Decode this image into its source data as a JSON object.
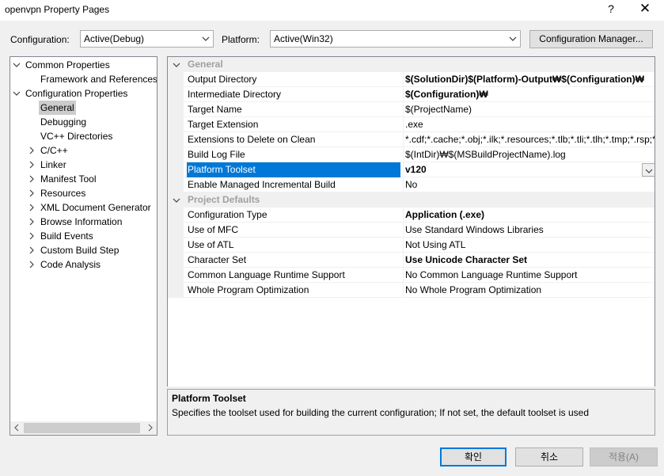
{
  "window": {
    "title": "openvpn Property Pages",
    "help_label": "?",
    "close_label": "✕"
  },
  "toolbar": {
    "configuration_label": "Configuration:",
    "configuration_value": "Active(Debug)",
    "platform_label": "Platform:",
    "platform_value": "Active(Win32)",
    "config_manager_label": "Configuration Manager..."
  },
  "tree": {
    "items": [
      {
        "label": "Common Properties",
        "level": 0,
        "expander": "expanded"
      },
      {
        "label": "Framework and References",
        "level": 1,
        "expander": "none"
      },
      {
        "label": "Configuration Properties",
        "level": 0,
        "expander": "expanded"
      },
      {
        "label": "General",
        "level": 1,
        "expander": "none",
        "selected": true
      },
      {
        "label": "Debugging",
        "level": 1,
        "expander": "none"
      },
      {
        "label": "VC++ Directories",
        "level": 1,
        "expander": "none"
      },
      {
        "label": "C/C++",
        "level": 1,
        "expander": "collapsed"
      },
      {
        "label": "Linker",
        "level": 1,
        "expander": "collapsed"
      },
      {
        "label": "Manifest Tool",
        "level": 1,
        "expander": "collapsed"
      },
      {
        "label": "Resources",
        "level": 1,
        "expander": "collapsed"
      },
      {
        "label": "XML Document Generator",
        "level": 1,
        "expander": "collapsed"
      },
      {
        "label": "Browse Information",
        "level": 1,
        "expander": "collapsed"
      },
      {
        "label": "Build Events",
        "level": 1,
        "expander": "collapsed"
      },
      {
        "label": "Custom Build Step",
        "level": 1,
        "expander": "collapsed"
      },
      {
        "label": "Code Analysis",
        "level": 1,
        "expander": "collapsed"
      }
    ]
  },
  "grid": {
    "sections": [
      {
        "category": "General",
        "rows": [
          {
            "name": "Output Directory",
            "value": "$(SolutionDir)$(Platform)-Output₩$(Configuration)₩",
            "bold": true
          },
          {
            "name": "Intermediate Directory",
            "value": "$(Configuration)₩",
            "bold": true
          },
          {
            "name": "Target Name",
            "value": "$(ProjectName)",
            "bold": false
          },
          {
            "name": "Target Extension",
            "value": ".exe",
            "bold": false
          },
          {
            "name": "Extensions to Delete on Clean",
            "value": "*.cdf;*.cache;*.obj;*.ilk;*.resources;*.tlb;*.tli;*.tlh;*.tmp;*.rsp;*",
            "bold": false
          },
          {
            "name": "Build Log File",
            "value": "$(IntDir)₩$(MSBuildProjectName).log",
            "bold": false
          },
          {
            "name": "Platform Toolset",
            "value": "v120",
            "bold": true,
            "selected": true
          },
          {
            "name": "Enable Managed Incremental Build",
            "value": "No",
            "bold": false
          }
        ]
      },
      {
        "category": "Project Defaults",
        "rows": [
          {
            "name": "Configuration Type",
            "value": "Application (.exe)",
            "bold": true
          },
          {
            "name": "Use of MFC",
            "value": "Use Standard Windows Libraries",
            "bold": false
          },
          {
            "name": "Use of ATL",
            "value": "Not Using ATL",
            "bold": false
          },
          {
            "name": "Character Set",
            "value": "Use Unicode Character Set",
            "bold": true
          },
          {
            "name": "Common Language Runtime Support",
            "value": "No Common Language Runtime Support",
            "bold": false
          },
          {
            "name": "Whole Program Optimization",
            "value": "No Whole Program Optimization",
            "bold": false
          }
        ]
      }
    ]
  },
  "description": {
    "title": "Platform Toolset",
    "text": "Specifies the toolset used for building the current configuration; If not set, the default toolset is used"
  },
  "buttons": {
    "ok": "확인",
    "cancel": "취소",
    "apply": "적용(A)"
  },
  "colors": {
    "selection": "#0078d7",
    "category_text": "#a0a0a0",
    "tree_selection": "#cccccc"
  },
  "icons": {
    "expanded": "chevron-down-icon",
    "collapsed": "chevron-right-icon",
    "dropdown": "chevron-down-icon"
  }
}
